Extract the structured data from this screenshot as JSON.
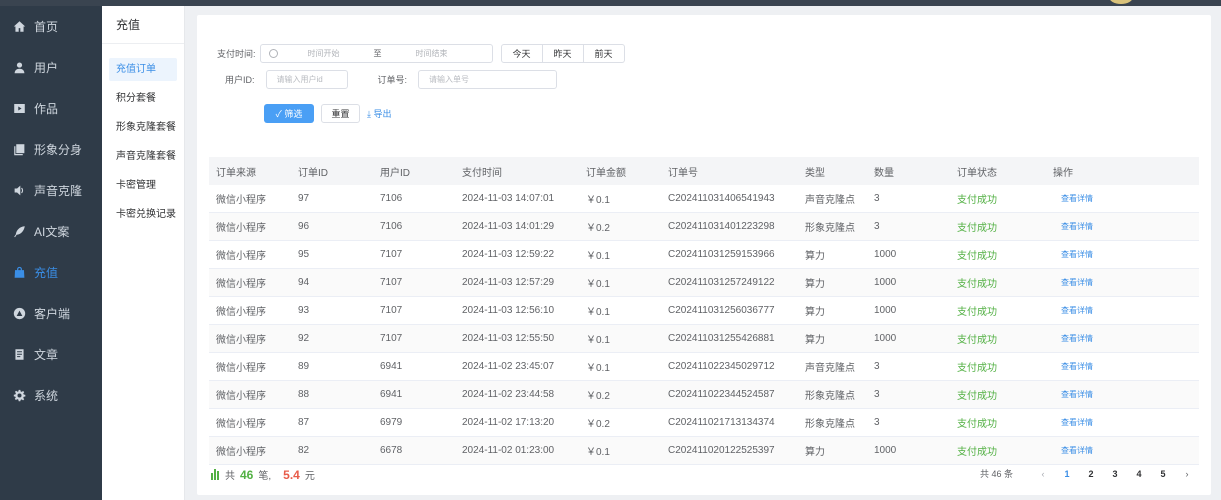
{
  "nav": {
    "items": [
      {
        "label": "首页",
        "icon": "home-icon"
      },
      {
        "label": "用户",
        "icon": "user-icon"
      },
      {
        "label": "作品",
        "icon": "video-icon"
      },
      {
        "label": "形象分身",
        "icon": "clone-icon"
      },
      {
        "label": "声音克隆",
        "icon": "voice-icon"
      },
      {
        "label": "AI文案",
        "icon": "feather-icon"
      },
      {
        "label": "充值",
        "icon": "bag-icon"
      },
      {
        "label": "客户端",
        "icon": "client-icon"
      },
      {
        "label": "文章",
        "icon": "article-icon"
      },
      {
        "label": "系统",
        "icon": "gear-icon"
      }
    ],
    "active_index": 6
  },
  "subnav": {
    "title": "充值",
    "items": [
      "充值订单",
      "积分套餐",
      "形象克隆套餐",
      "声音克隆套餐",
      "卡密管理",
      "卡密兑换记录"
    ],
    "active_index": 0
  },
  "filters": {
    "pay_time_label": "支付时间:",
    "start_placeholder": "时间开始",
    "range_sep": "至",
    "end_placeholder": "时间结束",
    "quick": [
      "今天",
      "昨天",
      "前天"
    ],
    "user_id_label": "用户ID:",
    "user_id_placeholder": "请输入用户id",
    "order_no_label": "订单号:",
    "order_no_placeholder": "请输入单号",
    "filter_btn": "✓ 筛选",
    "reset_btn": "重置",
    "export_btn": "⤓ 导出"
  },
  "table": {
    "columns": [
      "订单来源",
      "订单ID",
      "用户ID",
      "支付时间",
      "订单金额",
      "订单号",
      "类型",
      "数量",
      "订单状态",
      "操作"
    ],
    "rows": [
      [
        "微信小程序",
        "97",
        "7106",
        "2024-11-03 14:07:01",
        "￥0.1",
        "C202411031406541943",
        "声音克隆点",
        "3",
        "支付成功",
        "查看详情"
      ],
      [
        "微信小程序",
        "96",
        "7106",
        "2024-11-03 14:01:29",
        "￥0.2",
        "C202411031401223298",
        "形象克隆点",
        "3",
        "支付成功",
        "查看详情"
      ],
      [
        "微信小程序",
        "95",
        "7107",
        "2024-11-03 12:59:22",
        "￥0.1",
        "C202411031259153966",
        "算力",
        "1000",
        "支付成功",
        "查看详情"
      ],
      [
        "微信小程序",
        "94",
        "7107",
        "2024-11-03 12:57:29",
        "￥0.1",
        "C202411031257249122",
        "算力",
        "1000",
        "支付成功",
        "查看详情"
      ],
      [
        "微信小程序",
        "93",
        "7107",
        "2024-11-03 12:56:10",
        "￥0.1",
        "C202411031256036777",
        "算力",
        "1000",
        "支付成功",
        "查看详情"
      ],
      [
        "微信小程序",
        "92",
        "7107",
        "2024-11-03 12:55:50",
        "￥0.1",
        "C202411031255426881",
        "算力",
        "1000",
        "支付成功",
        "查看详情"
      ],
      [
        "微信小程序",
        "89",
        "6941",
        "2024-11-02 23:45:07",
        "￥0.1",
        "C202411022345029712",
        "声音克隆点",
        "3",
        "支付成功",
        "查看详情"
      ],
      [
        "微信小程序",
        "88",
        "6941",
        "2024-11-02 23:44:58",
        "￥0.2",
        "C202411022344524587",
        "形象克隆点",
        "3",
        "支付成功",
        "查看详情"
      ],
      [
        "微信小程序",
        "87",
        "6979",
        "2024-11-02 17:13:20",
        "￥0.2",
        "C202411021713134374",
        "形象克隆点",
        "3",
        "支付成功",
        "查看详情"
      ],
      [
        "微信小程序",
        "82",
        "6678",
        "2024-11-02 01:23:00",
        "￥0.1",
        "C202411020122525397",
        "算力",
        "1000",
        "支付成功",
        "查看详情"
      ]
    ]
  },
  "summary": {
    "prefix": "共",
    "count": "46",
    "count_unit": "笔,",
    "amount": "5.4",
    "amount_unit": "元"
  },
  "pager": {
    "total": "共 46 条",
    "prev": "‹",
    "pages": [
      "1",
      "2",
      "3",
      "4",
      "5"
    ],
    "current": "1",
    "next": "›"
  },
  "colors": {
    "sidebar_bg": "#2f3b48",
    "accent": "#3a8ee6",
    "success": "#52b043",
    "amount": "#e85c4a"
  }
}
